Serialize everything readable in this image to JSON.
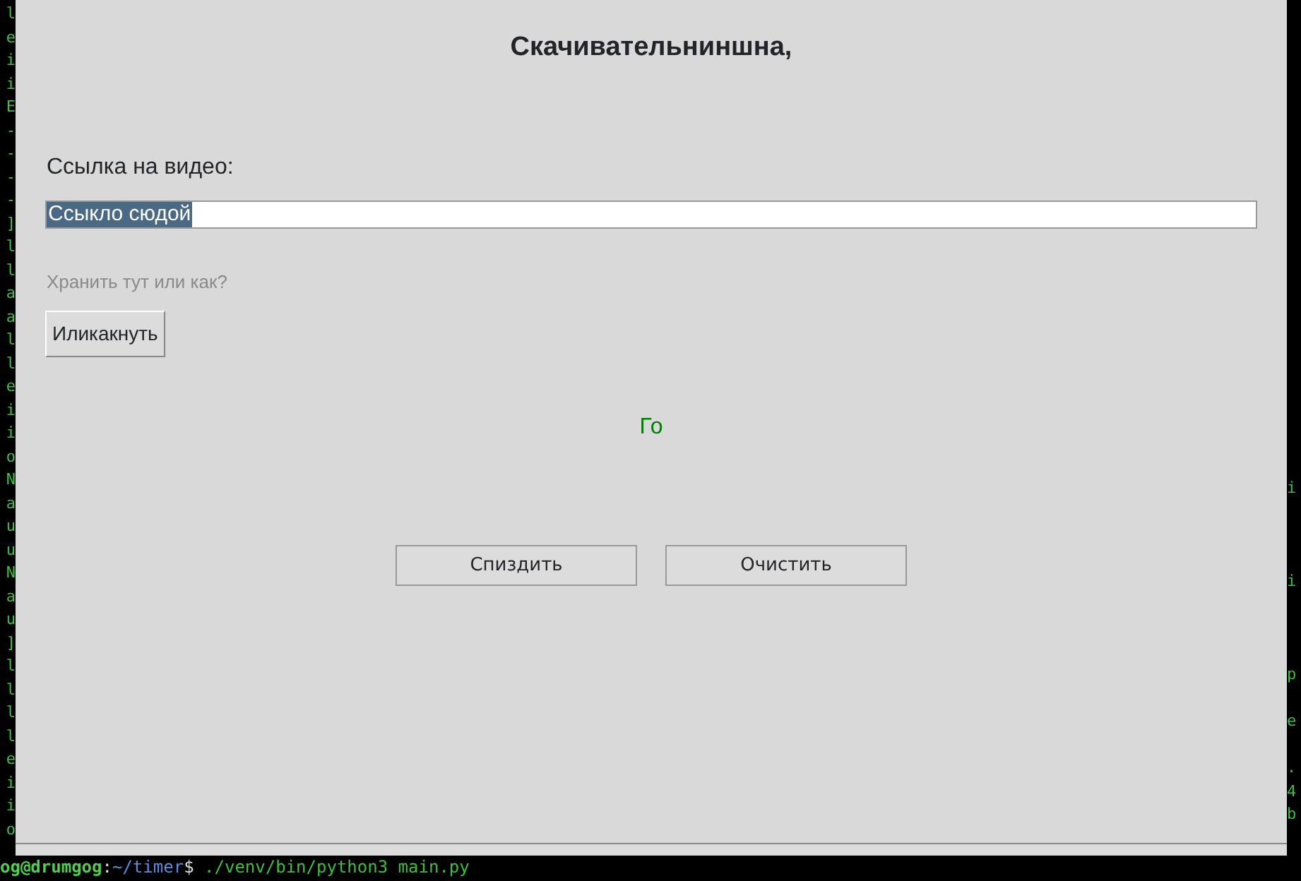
{
  "terminal": {
    "left_edge": [
      "l",
      "e",
      "i",
      "i",
      "E",
      "-",
      "-",
      "-",
      "-",
      "]",
      "l",
      "l",
      "a",
      "a",
      "l",
      "l",
      "e",
      "i",
      "i",
      "o",
      "N",
      "a",
      "u",
      "u",
      "N",
      "a",
      "u",
      "]",
      "l",
      "l",
      "l",
      "l",
      "e",
      "i",
      "i",
      "o"
    ],
    "right_edge": [
      "i",
      "i",
      "p",
      "e",
      ".",
      "4",
      "b"
    ],
    "prompt": {
      "user": "og@drumgog",
      "separator": ":",
      "path": "~/timer",
      "symbol": "$",
      "command": "./venv/bin/python3 main.py"
    }
  },
  "window": {
    "title": "Скачивательниншна,",
    "url_label": "Ссылка на видео:",
    "url_field": {
      "value": "Ссыкло сюдой",
      "selected": true
    },
    "save_hint": "Хранить тут или как?",
    "browse_button": "Иликакнуть",
    "status": {
      "text": "Го",
      "color": "#008000"
    },
    "buttons": [
      "Спиздить",
      "Очистить"
    ]
  }
}
